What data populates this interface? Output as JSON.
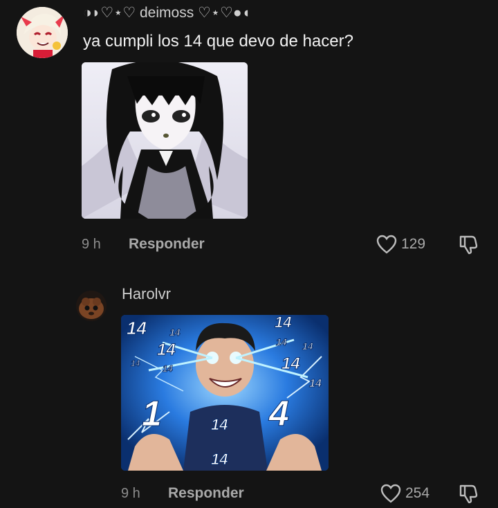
{
  "comments": [
    {
      "username": "◑◗♡⋆♡ deimoss ♡⋆♡●◖",
      "text": "ya cumpli los 14 que devo de hacer?",
      "time": "9 h",
      "reply_label": "Responder",
      "likes": "129",
      "avatar": "anime-character-avatar",
      "media": "anime-girl-image"
    },
    {
      "username": "Harolvr",
      "text": "",
      "time": "9 h",
      "reply_label": "Responder",
      "likes": "254",
      "avatar": "brown-creature-avatar",
      "media": "meme-glowing-eyes-14-image",
      "media_labels": [
        "14",
        "14",
        "14",
        "14",
        "14",
        "14",
        "14",
        "14",
        "14",
        "14",
        "1",
        "4",
        "14",
        "14"
      ]
    }
  ],
  "colors": {
    "background": "#141414",
    "text": "#f2f2f2",
    "muted": "#a9a9a9"
  }
}
